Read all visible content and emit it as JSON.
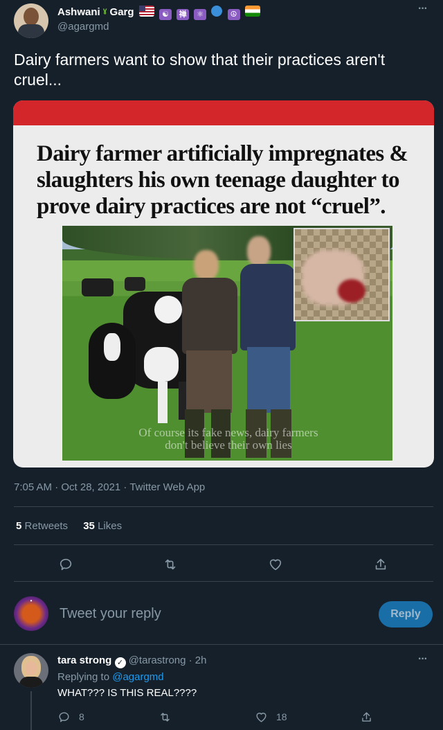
{
  "tweet": {
    "author_name": "Ashwani",
    "author_name_suffix": "Garg",
    "author_handle": "@agargmd",
    "text": "Dairy farmers want to show that their practices aren't cruel...",
    "image": {
      "headline": "Dairy farmer artificially impregnates & slaughters his own teenage daughter to prove dairy practices are not “cruel”.",
      "watermark_line1": "Of course its fake news, dairy farmers",
      "watermark_line2": "don't believe their own lies"
    },
    "meta": "7:05 AM · Oct 28, 2021 · Twitter Web App",
    "retweets_count": "5",
    "retweets_label": "Retweets",
    "likes_count": "35",
    "likes_label": "Likes",
    "more_label": "···",
    "badge_text": "禅"
  },
  "compose": {
    "placeholder": "Tweet your reply",
    "reply_button": "Reply"
  },
  "reply": {
    "author_name": "tara strong",
    "author_handle": "@tarastrong",
    "time": "· 2h",
    "replying_to_label": "Replying to",
    "replying_to_handle": "@agargmd",
    "text": "WHAT??? IS THIS REAL????",
    "reply_count": "8",
    "like_count": "18",
    "more_label": "···"
  },
  "colors": {
    "background": "#15202b",
    "accent": "#1d9bf0",
    "muted": "#8899a6",
    "divider": "#38444d",
    "banner_red": "#d3262b"
  }
}
